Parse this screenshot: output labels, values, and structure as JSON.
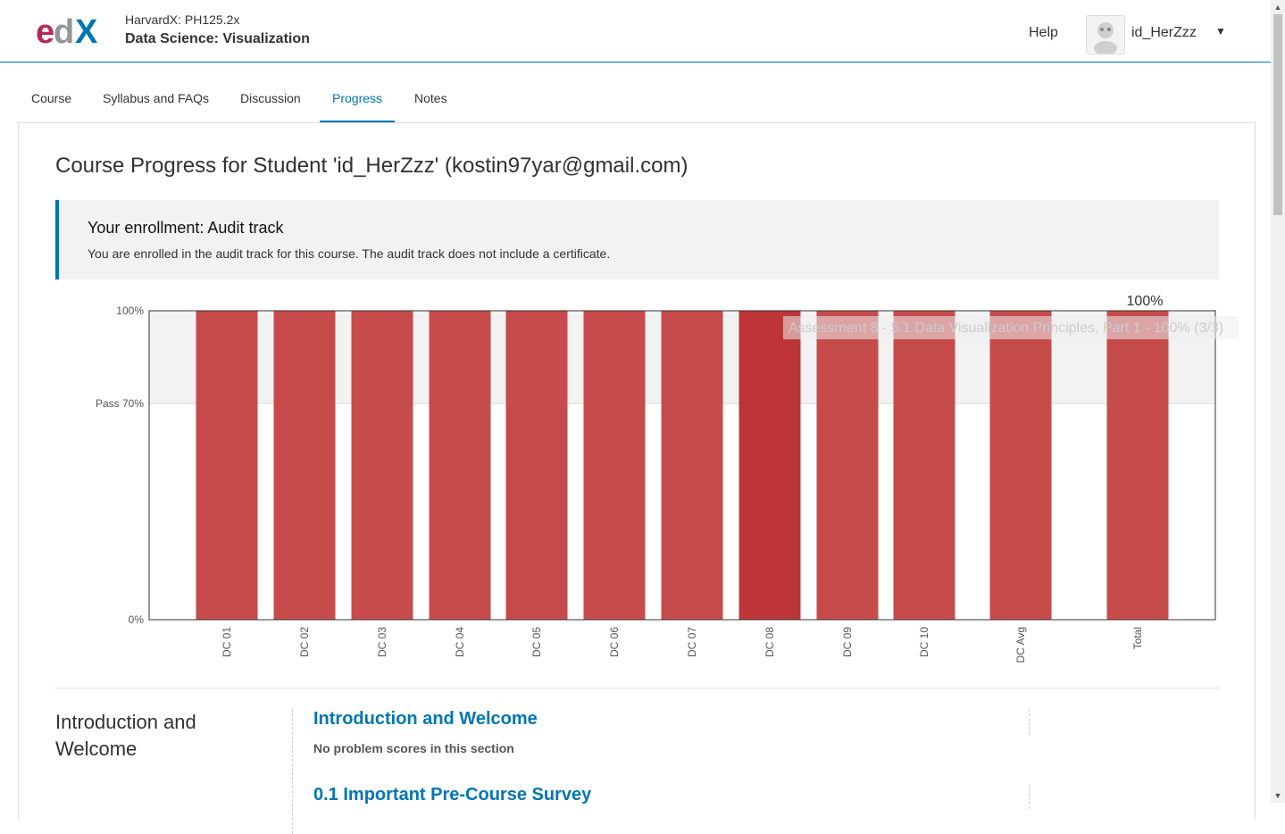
{
  "header": {
    "course_org": "HarvardX: PH125.2x",
    "course_name": "Data Science: Visualization",
    "help_label": "Help",
    "username": "id_HerZzz",
    "caret": "▼"
  },
  "tabs": [
    {
      "label": "Course"
    },
    {
      "label": "Syllabus and FAQs"
    },
    {
      "label": "Discussion"
    },
    {
      "label": "Progress"
    },
    {
      "label": "Notes"
    }
  ],
  "page_title": "Course Progress for Student 'id_HerZzz' (kostin97yar@gmail.com)",
  "enrollment": {
    "title": "Your enrollment: Audit track",
    "description": "You are enrolled in the audit track for this course. The audit track does not include a certificate."
  },
  "chart_data": {
    "type": "bar",
    "categories": [
      "DC 01",
      "DC 02",
      "DC 03",
      "DC 04",
      "DC 05",
      "DC 06",
      "DC 07",
      "DC 08",
      "DC 09",
      "DC 10",
      "DC Avg",
      "Total"
    ],
    "values": [
      100,
      100,
      100,
      100,
      100,
      100,
      100,
      100,
      100,
      100,
      100,
      100
    ],
    "ylim": [
      0,
      100
    ],
    "y_ticks": [
      "100%",
      "Pass 70%",
      "0%"
    ],
    "total_label": "100%",
    "tooltip": "Assessment 8 - 5.1 Data Visualization Principles, Part 1 - 100% (3/3)",
    "bar_color": "#c64b4b",
    "highlight_color": "#bd3538",
    "pass_band_color": "#f2f2f2"
  },
  "sections": {
    "chapter_name": "Introduction and Welcome",
    "items": [
      {
        "title": "Introduction and Welcome",
        "note": "No problem scores in this section"
      },
      {
        "title": "0.1 Important Pre-Course Survey"
      }
    ]
  }
}
